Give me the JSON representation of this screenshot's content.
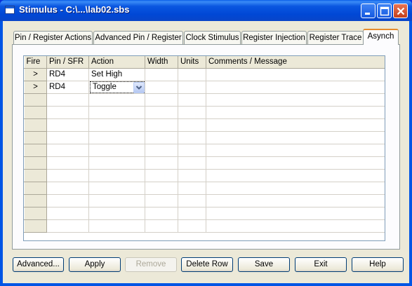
{
  "window": {
    "title": "Stimulus - C:\\...\\lab02.sbs"
  },
  "titlebar": {
    "minimize": "minimize-icon",
    "maximize": "maximize-icon",
    "close": "close-icon"
  },
  "tabs": [
    {
      "label": "Pin / Register Actions"
    },
    {
      "label": "Advanced Pin / Register"
    },
    {
      "label": "Clock Stimulus"
    },
    {
      "label": "Register Injection"
    },
    {
      "label": "Register Trace"
    },
    {
      "label": "Asynch"
    }
  ],
  "active_tab": "Asynch",
  "grid": {
    "columns": [
      "Fire",
      "Pin / SFR",
      "Action",
      "Width",
      "Units",
      "Comments / Message"
    ],
    "fire_glyph": ">",
    "rows": [
      {
        "pin": "RD4",
        "action": "Set High",
        "width": "",
        "units": "",
        "comment": ""
      },
      {
        "pin": "RD4",
        "action": "Toggle",
        "width": "",
        "units": "",
        "comment": ""
      }
    ],
    "empty_rows": 11
  },
  "buttons": {
    "advanced": "Advanced...",
    "apply": "Apply",
    "remove": "Remove",
    "delete_row": "Delete Row",
    "save": "Save",
    "exit": "Exit",
    "help": "Help"
  }
}
